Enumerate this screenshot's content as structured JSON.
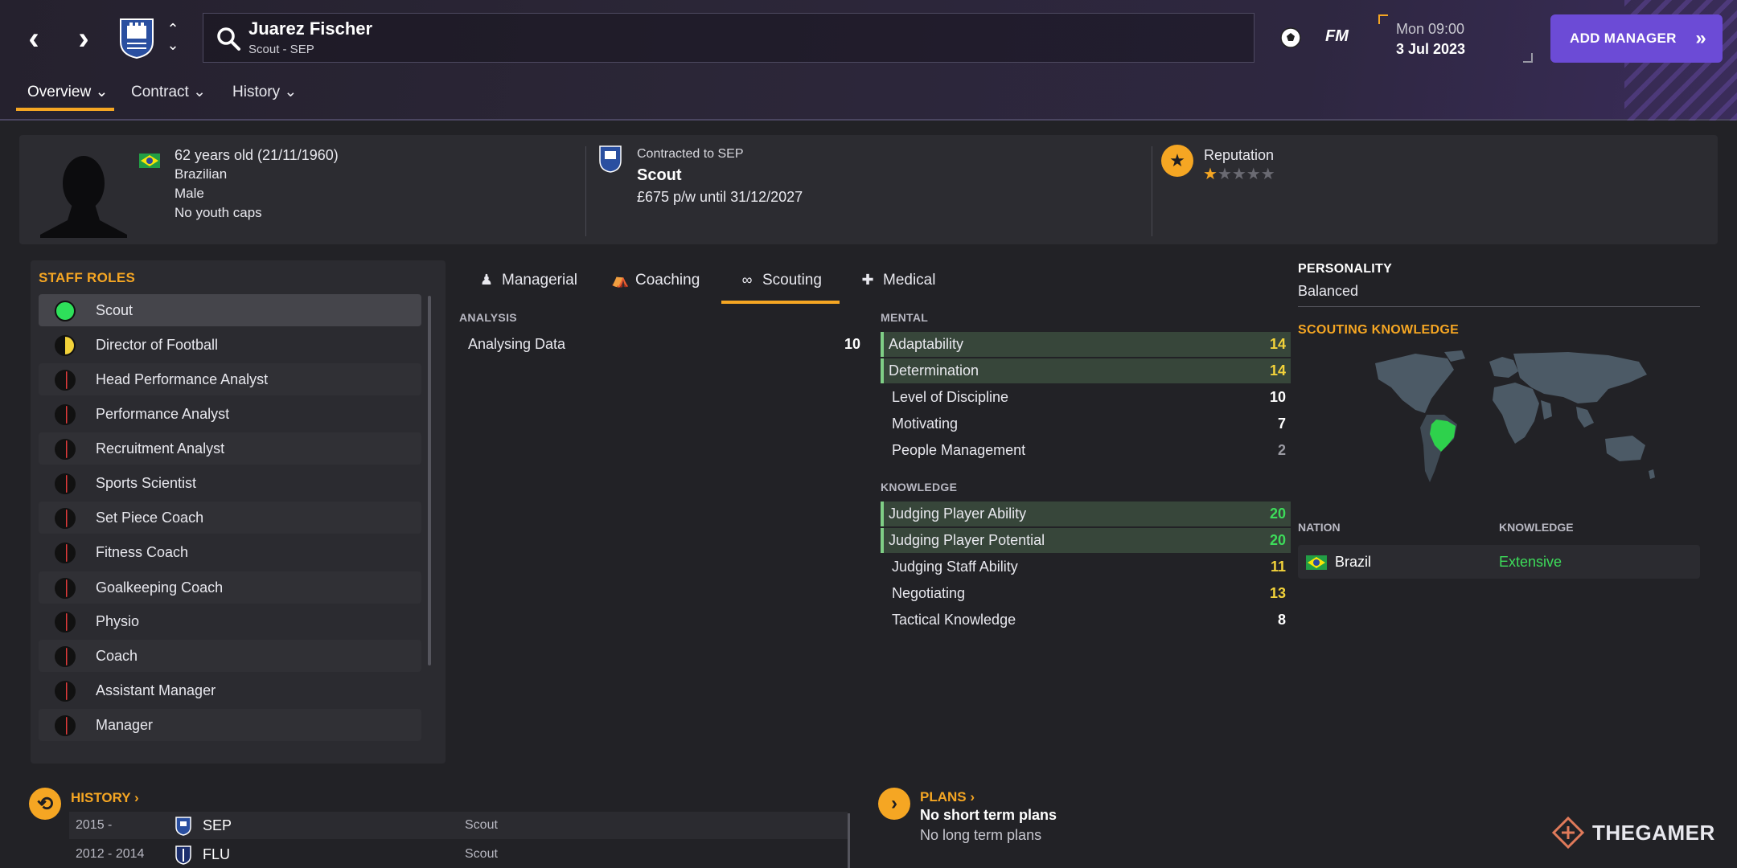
{
  "header": {
    "person_name": "Juarez Fischer",
    "person_sub": "Scout - SEP",
    "fm_label": "FM",
    "date_day": "Mon 09:00",
    "date_full": "3 Jul 2023",
    "add_manager": "ADD MANAGER"
  },
  "subnav": [
    {
      "label": "Overview"
    },
    {
      "label": "Contract"
    },
    {
      "label": "History"
    }
  ],
  "profile": {
    "age": "62 years old (21/11/1960)",
    "nationality": "Brazilian",
    "gender": "Male",
    "caps": "No youth caps",
    "contract_line": "Contracted to SEP",
    "role": "Scout",
    "wage": "£675 p/w until 31/12/2027",
    "reputation_label": "Reputation",
    "reputation_stars": 0.5,
    "reputation_max": 5
  },
  "staff_roles": {
    "title": "STAFF ROLES",
    "items": [
      {
        "label": "Scout",
        "suitability": "high",
        "color": "#2ee05a"
      },
      {
        "label": "Director of Football",
        "suitability": "medium",
        "color": "#f2d23a"
      },
      {
        "label": "Head Performance Analyst",
        "suitability": "low",
        "color": "#e03a3a"
      },
      {
        "label": "Performance Analyst",
        "suitability": "low",
        "color": "#e03a3a"
      },
      {
        "label": "Recruitment Analyst",
        "suitability": "low",
        "color": "#e03a3a"
      },
      {
        "label": "Sports Scientist",
        "suitability": "low",
        "color": "#e03a3a"
      },
      {
        "label": "Set Piece Coach",
        "suitability": "low",
        "color": "#e03a3a"
      },
      {
        "label": "Fitness Coach",
        "suitability": "low",
        "color": "#e03a3a"
      },
      {
        "label": "Goalkeeping Coach",
        "suitability": "low",
        "color": "#e03a3a"
      },
      {
        "label": "Physio",
        "suitability": "low",
        "color": "#e03a3a"
      },
      {
        "label": "Coach",
        "suitability": "low",
        "color": "#e03a3a"
      },
      {
        "label": "Assistant Manager",
        "suitability": "low",
        "color": "#e03a3a"
      },
      {
        "label": "Manager",
        "suitability": "low",
        "color": "#e03a3a"
      }
    ]
  },
  "tabs": [
    {
      "label": "Managerial",
      "icon": "managerial-icon"
    },
    {
      "label": "Coaching",
      "icon": "coaching-icon"
    },
    {
      "label": "Scouting",
      "icon": "binoculars-icon"
    },
    {
      "label": "Medical",
      "icon": "medical-kit-icon"
    }
  ],
  "analysis": {
    "title": "ANALYSIS",
    "items": [
      {
        "name": "Analysing Data",
        "value": "10"
      }
    ]
  },
  "mental": {
    "title": "MENTAL",
    "items": [
      {
        "name": "Adaptability",
        "value": "14"
      },
      {
        "name": "Determination",
        "value": "14"
      },
      {
        "name": "Level of Discipline",
        "value": "10"
      },
      {
        "name": "Motivating",
        "value": "7"
      },
      {
        "name": "People Management",
        "value": "2"
      }
    ]
  },
  "knowledge": {
    "title": "KNOWLEDGE",
    "items": [
      {
        "name": "Judging Player Ability",
        "value": "20"
      },
      {
        "name": "Judging Player Potential",
        "value": "20"
      },
      {
        "name": "Judging Staff Ability",
        "value": "11"
      },
      {
        "name": "Negotiating",
        "value": "13"
      },
      {
        "name": "Tactical Knowledge",
        "value": "8"
      }
    ]
  },
  "personality": {
    "title": "PERSONALITY",
    "value": "Balanced"
  },
  "scouting_knowledge": {
    "title": "SCOUTING KNOWLEDGE",
    "col_nation": "NATION",
    "col_knowledge": "KNOWLEDGE",
    "rows": [
      {
        "nation": "Brazil",
        "knowledge": "Extensive"
      }
    ]
  },
  "history": {
    "title": "HISTORY",
    "rows": [
      {
        "years": "2015 -",
        "club": "SEP",
        "role": "Scout"
      },
      {
        "years": "2012 - 2014",
        "club": "FLU",
        "role": "Scout"
      }
    ]
  },
  "plans": {
    "title": "PLANS",
    "short": "No short term plans",
    "long": "No long term plans"
  },
  "watermark": "THEGAMER",
  "colors": {
    "accent": "#f5a623",
    "brand": "#6c4bd6",
    "good": "#3ddc5a",
    "ok": "#f2d23a"
  }
}
